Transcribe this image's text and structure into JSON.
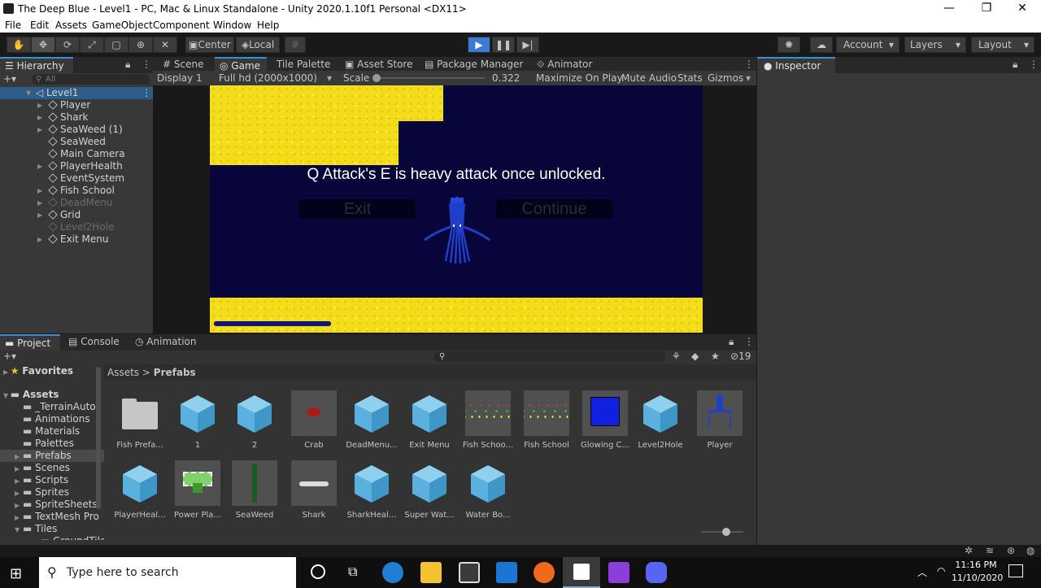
{
  "window": {
    "title": "The Deep Blue - Level1 - PC, Mac & Linux Standalone - Unity 2020.1.10f1 Personal <DX11>",
    "minimize": "—",
    "maximize": "❐",
    "close": "✕"
  },
  "menu": [
    "File",
    "Edit",
    "Assets",
    "GameObject",
    "Component",
    "Window",
    "Help"
  ],
  "toolbar": {
    "pivot": "Center",
    "space": "Local",
    "account": "Account",
    "layers": "Layers",
    "layout": "Layout"
  },
  "hierarchy": {
    "tab": "Hierarchy",
    "search_placeholder": "All",
    "scene": "Level1",
    "items": [
      {
        "label": "Player",
        "arrow": true,
        "dim": false
      },
      {
        "label": "Shark",
        "arrow": true,
        "dim": false
      },
      {
        "label": "SeaWeed (1)",
        "arrow": true,
        "dim": false
      },
      {
        "label": "SeaWeed",
        "arrow": false,
        "dim": false
      },
      {
        "label": "Main Camera",
        "arrow": false,
        "dim": false
      },
      {
        "label": "PlayerHealth",
        "arrow": true,
        "dim": false
      },
      {
        "label": "EventSystem",
        "arrow": false,
        "dim": false
      },
      {
        "label": "Fish School",
        "arrow": true,
        "dim": false
      },
      {
        "label": "DeadMenu",
        "arrow": true,
        "dim": true
      },
      {
        "label": "Grid",
        "arrow": true,
        "dim": false
      },
      {
        "label": "Level2Hole",
        "arrow": false,
        "dim": true
      },
      {
        "label": "Exit Menu",
        "arrow": true,
        "dim": false
      }
    ]
  },
  "center_tabs": [
    "Scene",
    "Game",
    "Tile Palette",
    "Asset Store",
    "Package Manager",
    "Animator"
  ],
  "game_bar": {
    "display": "Display 1",
    "resolution": "Full hd (2000x1000)",
    "scale_label": "Scale",
    "scale_value": "0.322",
    "maximize": "Maximize On Play",
    "mute": "Mute Audio",
    "stats": "Stats",
    "gizmos": "Gizmos"
  },
  "game": {
    "message": "Q Attack's E is heavy attack once unlocked.",
    "exit_button": "Exit",
    "continue_button": "Continue",
    "health_fraction": 0.23
  },
  "inspector": {
    "tab": "Inspector"
  },
  "bottom_tabs": [
    "Project",
    "Console",
    "Animation"
  ],
  "project": {
    "hidden_count": "19",
    "breadcrumb_root": "Assets",
    "breadcrumb_sep": ">",
    "breadcrumb_current": "Prefabs",
    "favorites": "Favorites",
    "assets_root": "Assets",
    "folders": [
      "_TerrainAutol",
      "Animations",
      "Materials",
      "Palettes",
      "Prefabs",
      "Scenes",
      "Scripts",
      "Sprites",
      "SpriteSheets",
      "TextMesh Pro",
      "Tiles",
      "GroundTile"
    ],
    "items": [
      {
        "label": "Fish Prefa...",
        "icon": "folder"
      },
      {
        "label": "1",
        "icon": "cube"
      },
      {
        "label": "2",
        "icon": "cube"
      },
      {
        "label": "Crab",
        "icon": "crab"
      },
      {
        "label": "DeadMenu...",
        "icon": "cube"
      },
      {
        "label": "Exit Menu",
        "icon": "cube"
      },
      {
        "label": "Fish Schoo...",
        "icon": "fish"
      },
      {
        "label": "Fish School",
        "icon": "fish"
      },
      {
        "label": "Glowing C...",
        "icon": "square"
      },
      {
        "label": "Level2Hole",
        "icon": "cube"
      },
      {
        "label": "Player",
        "icon": "squid"
      },
      {
        "label": "PlayerHeal...",
        "icon": "cube"
      },
      {
        "label": "Power Pla...",
        "icon": "power"
      },
      {
        "label": "SeaWeed",
        "icon": "seaweed"
      },
      {
        "label": "Shark",
        "icon": "shark"
      },
      {
        "label": "SharkHeal...",
        "icon": "cube"
      },
      {
        "label": "Super Wat...",
        "icon": "cube"
      },
      {
        "label": "Water Bo...",
        "icon": "cube"
      }
    ]
  },
  "taskbar": {
    "search_placeholder": "Type here to search",
    "time": "11:16 PM",
    "date": "11/10/2020"
  },
  "colors": {
    "accent": "#3b7bd1",
    "sand": "#f3dd1a",
    "ocean": "#07053a",
    "squid": "#1e3fc8"
  }
}
